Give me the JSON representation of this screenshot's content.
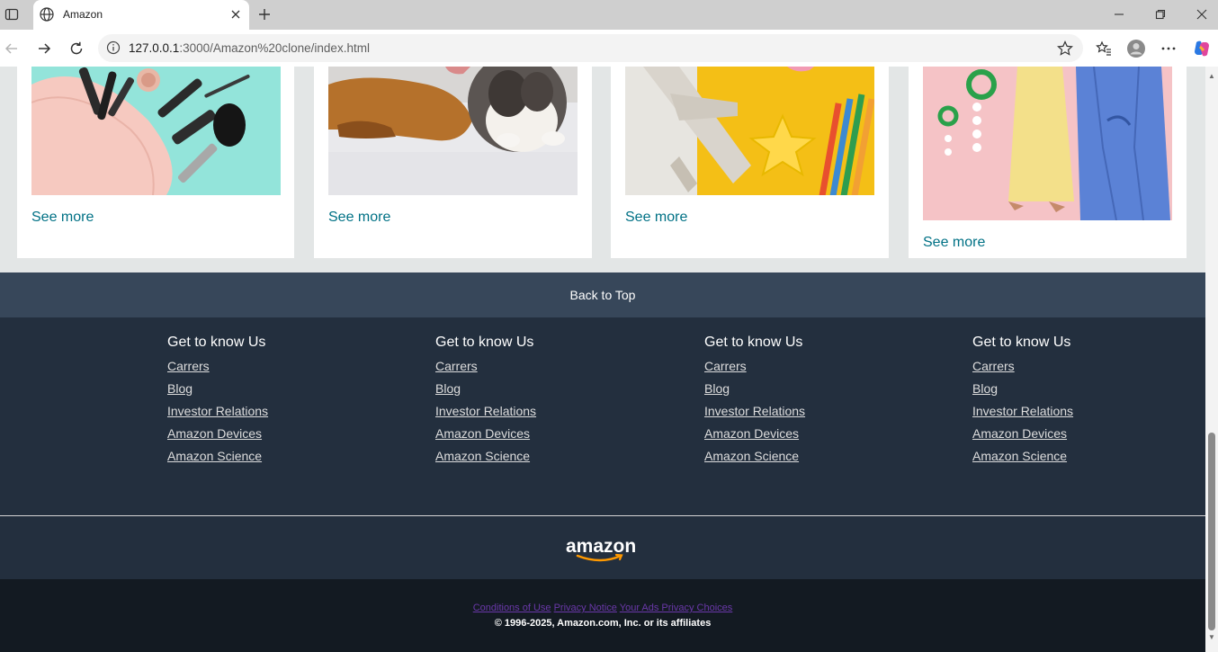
{
  "browser": {
    "tab_title": "Amazon",
    "url_host": "127.0.0.1",
    "url_rest": ":3000/Amazon%20clone/index.html"
  },
  "cards": [
    {
      "see_more": "See more",
      "image": "cosmetics-bag-photo"
    },
    {
      "see_more": "See more",
      "image": "dog-and-cat-photo"
    },
    {
      "see_more": "See more",
      "image": "toys-and-pencils-photo"
    },
    {
      "see_more": "See more",
      "image": "fashion-dresses-photo"
    }
  ],
  "back_to_top": "Back to Top",
  "footer": {
    "columns": [
      {
        "title": "Get to know Us",
        "links": [
          "Carrers",
          "Blog",
          "Investor Relations",
          "Amazon Devices",
          "Amazon Science"
        ]
      },
      {
        "title": "Get to know Us",
        "links": [
          "Carrers",
          "Blog",
          "Investor Relations",
          "Amazon Devices",
          "Amazon Science"
        ]
      },
      {
        "title": "Get to know Us",
        "links": [
          "Carrers",
          "Blog",
          "Investor Relations",
          "Amazon Devices",
          "Amazon Science"
        ]
      },
      {
        "title": "Get to know Us",
        "links": [
          "Carrers",
          "Blog",
          "Investor Relations",
          "Amazon Devices",
          "Amazon Science"
        ]
      }
    ],
    "logo_text": "amazon",
    "legal_links": [
      "Conditions of Use",
      "Privacy Notice",
      "Your Ads Privacy Choices"
    ],
    "copyright": "© 1996-2025, Amazon.com, Inc. or its affiliates"
  },
  "colors": {
    "link_teal": "#007185",
    "back_to_top_bg": "#37475a",
    "footer_bg": "#232f3e",
    "bottom_bg": "#131a22",
    "amazon_orange": "#ff9900"
  }
}
